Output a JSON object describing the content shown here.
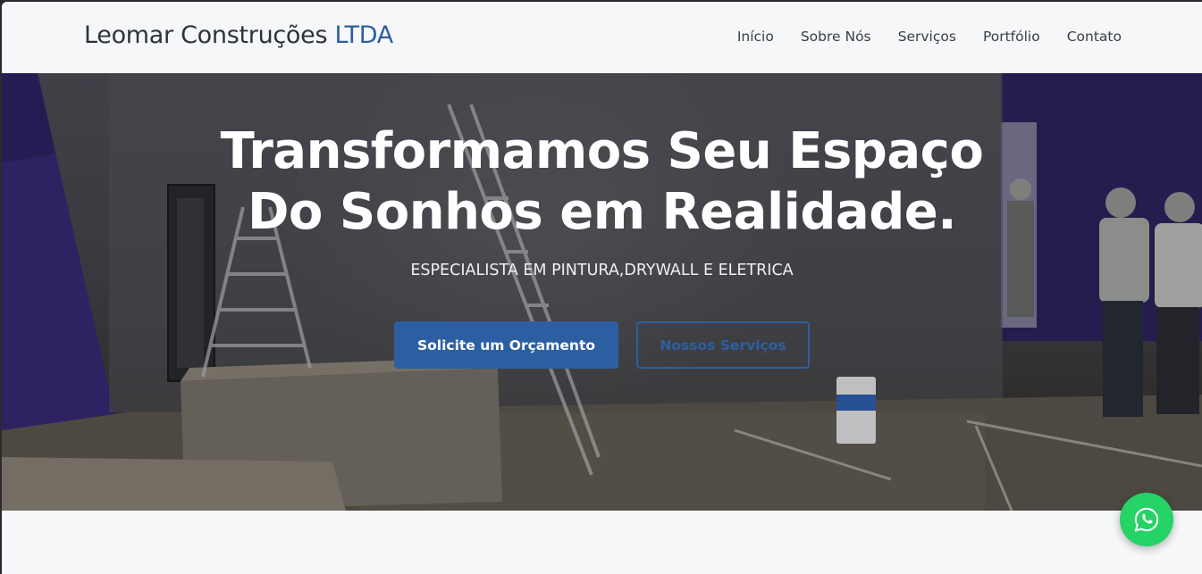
{
  "brand": {
    "name": "Leomar Construções",
    "suffix": "LTDA",
    "accent_color": "#2d5fa0"
  },
  "nav": {
    "items": [
      {
        "label": "Início"
      },
      {
        "label": "Sobre Nós"
      },
      {
        "label": "Serviços"
      },
      {
        "label": "Portfólio"
      },
      {
        "label": "Contato"
      }
    ]
  },
  "hero": {
    "title_line1": "Transformamos Seu Espaço",
    "title_line2": "Do Sonhos em Realidade.",
    "subtitle": "ESPECIALISTA EM PINTURA,DRYWALL E ELETRICA",
    "primary_button": "Solicite um Orçamento",
    "secondary_button": "Nossos Serviços",
    "background_image": "construction-site-photo"
  },
  "floating": {
    "icon": "whatsapp-icon",
    "color": "#25d366"
  },
  "colors": {
    "primary": "#2c5fa2"
  }
}
